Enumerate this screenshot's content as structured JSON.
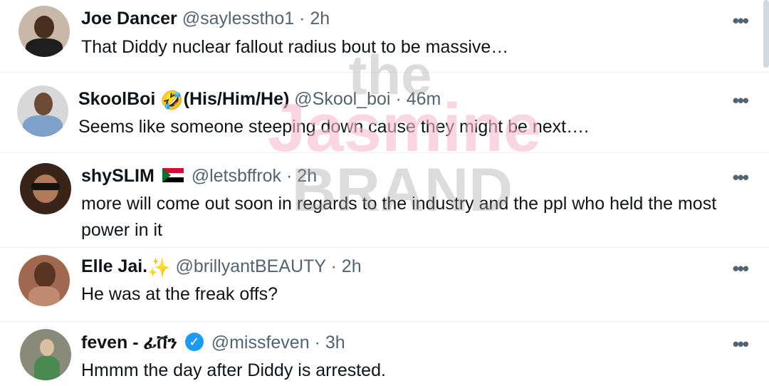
{
  "tweets": [
    {
      "name": "Joe Dancer",
      "handle": "@saylesstho1",
      "dot": "·",
      "time": "2h",
      "text": "That Diddy nuclear fallout radius bout to be massive…",
      "more": "•••"
    },
    {
      "name": "SkoolBoi",
      "emoji": "🤣",
      "pronouns": "(His/Him/He)",
      "handle": "@Skool_boi",
      "dot": "·",
      "time": "46m",
      "text": "Seems like someone steeping down cause they might be next….",
      "more": "•••"
    },
    {
      "name": "shySLIM",
      "handle": "@letsbffrok",
      "dot": "·",
      "time": "2h",
      "text": "more will come out soon in regards to the industry and the ppl who held the most power in it",
      "more": "•••"
    },
    {
      "name": "Elle Jai.",
      "emoji": "✨",
      "handle": "@brillyantBEAUTY",
      "dot": "·",
      "time": "2h",
      "text": "He was at the freak offs?",
      "more": "•••"
    },
    {
      "name": "feven - ፊቨን",
      "verified_icon": "✓",
      "handle": "@missfeven",
      "dot": "·",
      "time": "3h",
      "text": "Hmmm the day after Diddy is arrested.",
      "more": "•••"
    }
  ],
  "watermark": {
    "line1": "the",
    "line2": "Jasmine",
    "line3": "BRAND"
  },
  "colors": {
    "text": "#0f1419",
    "secondary": "#536471",
    "verified": "#1d9bf0",
    "watermark_pink": "#f7b9cf",
    "watermark_gray": "#9a9a9a"
  }
}
